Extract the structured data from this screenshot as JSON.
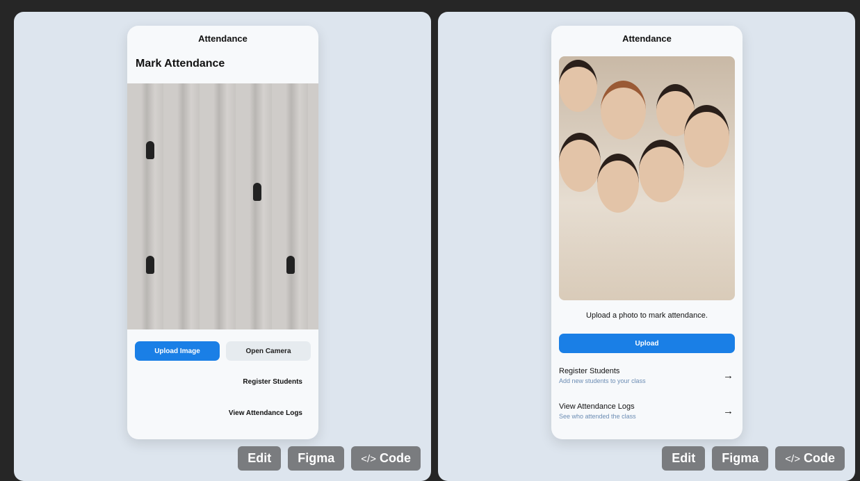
{
  "left": {
    "header": "Attendance",
    "title": "Mark Attendance",
    "upload_image": "Upload Image",
    "open_camera": "Open Camera",
    "register": "Register Students",
    "logs": "View Attendance Logs"
  },
  "right": {
    "header": "Attendance",
    "caption": "Upload a photo to mark attendance.",
    "upload": "Upload",
    "items": [
      {
        "title": "Register Students",
        "subtitle": "Add new students to your class"
      },
      {
        "title": "View Attendance Logs",
        "subtitle": "See who attended the class"
      }
    ]
  },
  "toolbar": {
    "edit": "Edit",
    "figma": "Figma",
    "code": "Code",
    "code_icon": "</>"
  },
  "colors": {
    "accent": "#1a7fe6",
    "panel": "#dde5ee"
  }
}
